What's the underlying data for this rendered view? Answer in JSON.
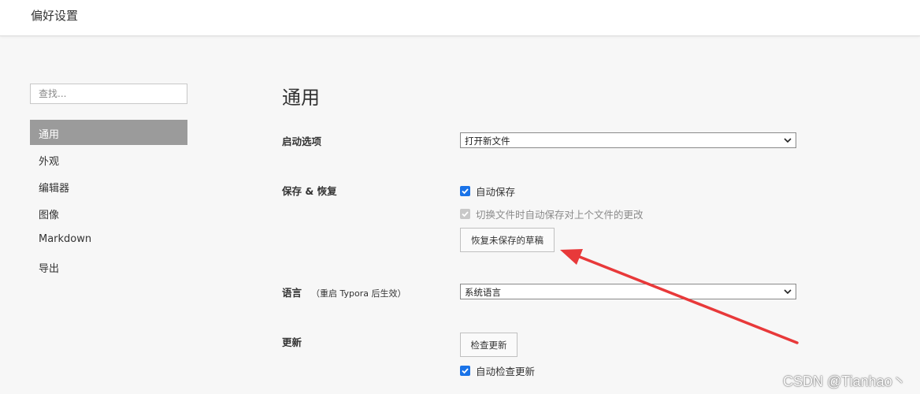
{
  "window": {
    "title": "偏好设置"
  },
  "sidebar": {
    "search_placeholder": "查找...",
    "items": [
      {
        "label": "通用",
        "active": true
      },
      {
        "label": "外观"
      },
      {
        "label": "编辑器"
      },
      {
        "label": "图像"
      },
      {
        "label": "Markdown"
      },
      {
        "label": "导出"
      }
    ]
  },
  "main": {
    "heading": "通用",
    "startup": {
      "label": "启动选项",
      "selected": "打开新文件"
    },
    "save": {
      "label": "保存 & 恢复",
      "autosave_label": "自动保存",
      "autosave_checked": true,
      "switch_save_label": "切换文件时自动保存对上个文件的更改",
      "switch_save_checked": true,
      "switch_save_disabled": true,
      "recover_button": "恢复未保存的草稿"
    },
    "language": {
      "label": "语言",
      "note": "（重启 Typora 后生效）",
      "selected": "系统语言"
    },
    "update": {
      "label": "更新",
      "check_button": "检查更新",
      "auto_check_label": "自动检查更新",
      "auto_check_checked": true
    }
  },
  "annotation": {
    "arrow_color": "#e8393a"
  },
  "watermark": "CSDN @Tianhao丶"
}
